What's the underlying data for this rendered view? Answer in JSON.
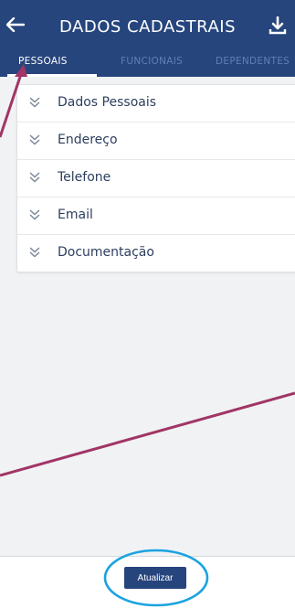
{
  "header": {
    "title": "DADOS CADASTRAIS",
    "back_icon": "arrow-left-icon",
    "download_icon": "download-icon",
    "background": "#26457d"
  },
  "tabs": [
    {
      "label": "PESSOAIS",
      "active": true
    },
    {
      "label": "FUNCIONAIS",
      "active": false
    },
    {
      "label": "DEPENDENTES",
      "active": false
    }
  ],
  "sections": [
    {
      "label": "Dados Pessoais",
      "icon": "chevron-double-down-icon"
    },
    {
      "label": "Endereço",
      "icon": "chevron-double-down-icon"
    },
    {
      "label": "Telefone",
      "icon": "chevron-double-down-icon"
    },
    {
      "label": "Email",
      "icon": "chevron-double-down-icon"
    },
    {
      "label": "Documentação",
      "icon": "chevron-double-down-icon"
    }
  ],
  "footer": {
    "update_label": "Atualizar"
  },
  "annotations": {
    "arrow_color": "#a13565",
    "circle_color": "#1aa3e0"
  }
}
